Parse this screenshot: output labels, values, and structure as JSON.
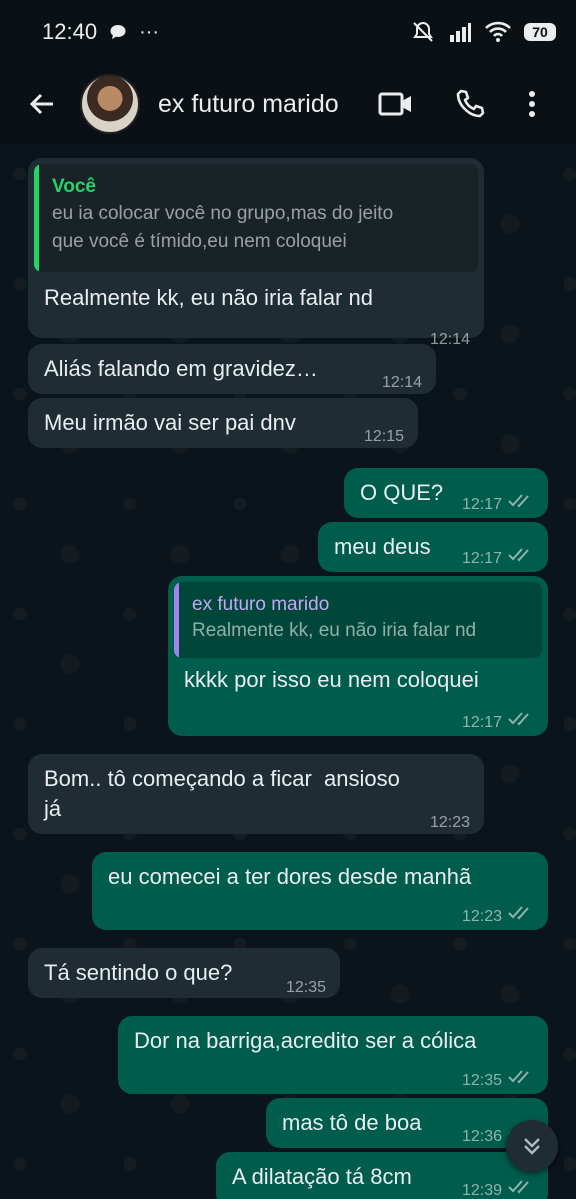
{
  "status_bar": {
    "time": "12:40",
    "more": "···",
    "battery": "70"
  },
  "header": {
    "contact_name": "ex futuro marido"
  },
  "colors": {
    "incoming": "#202c33",
    "outgoing": "#005c4b",
    "accent_green": "#25d366",
    "quote_purple": "#a281f0"
  },
  "messages": [
    {
      "dir": "in",
      "quote_author": "Você",
      "quote_text": "eu ia colocar você no grupo,mas do jeito\nque você é tímido,eu nem coloquei",
      "text": "Realmente kk, eu não iria falar nd",
      "time": "12:14"
    },
    {
      "dir": "in",
      "text": "Aliás falando em gravidez…",
      "time": "12:14"
    },
    {
      "dir": "in",
      "text": "Meu irmão vai ser pai dnv",
      "time": "12:15"
    },
    {
      "dir": "out",
      "text": "O QUE?",
      "time": "12:17"
    },
    {
      "dir": "out",
      "text": "meu deus",
      "time": "12:17"
    },
    {
      "dir": "out",
      "quote_author": "ex futuro marido",
      "quote_text": "Realmente kk, eu não iria falar nd",
      "text": "kkkk por isso eu nem coloquei",
      "time": "12:17"
    },
    {
      "dir": "in",
      "text": "Bom.. tô começando a ficar  ansioso\njá",
      "time": "12:23"
    },
    {
      "dir": "out",
      "text": "eu comecei a ter dores desde manhã",
      "time": "12:23"
    },
    {
      "dir": "in",
      "text": "Tá sentindo o que?",
      "time": "12:35"
    },
    {
      "dir": "out",
      "text": "Dor na barriga,acredito ser a cólica",
      "time": "12:35"
    },
    {
      "dir": "out",
      "text": "mas tô de boa",
      "time": "12:36"
    },
    {
      "dir": "out",
      "text": "A dilatação tá 8cm",
      "time": "12:39"
    }
  ]
}
